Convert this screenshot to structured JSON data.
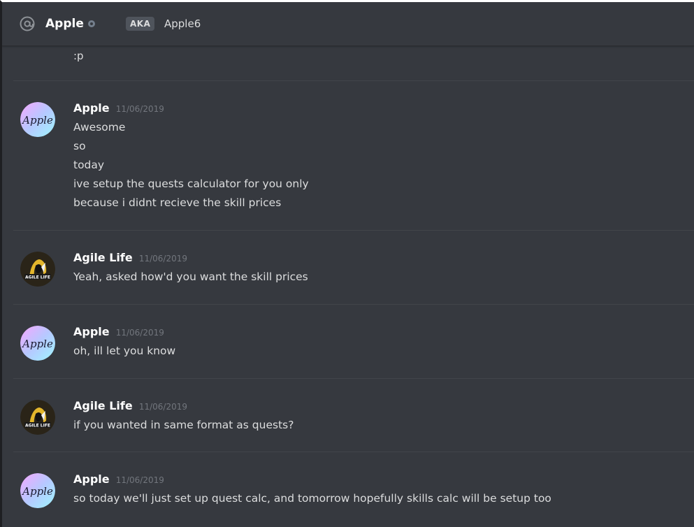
{
  "header": {
    "name": "Apple",
    "aka_label": "AKA",
    "aka_value": "Apple6"
  },
  "continuation_text": ":p",
  "messages": [
    {
      "author": "Apple",
      "timestamp": "11/06/2019",
      "avatar": "apple-avatar",
      "lines": [
        "Awesome",
        "so",
        "today",
        "ive setup the quests calculator for you only",
        "because i didnt recieve the skill prices"
      ]
    },
    {
      "author": "Agile Life",
      "timestamp": "11/06/2019",
      "avatar": "agile-life-avatar",
      "lines": [
        "Yeah, asked how'd you want the skill prices"
      ]
    },
    {
      "author": "Apple",
      "timestamp": "11/06/2019",
      "avatar": "apple-avatar",
      "lines": [
        "oh, ill let you know"
      ]
    },
    {
      "author": "Agile Life",
      "timestamp": "11/06/2019",
      "avatar": "agile-life-avatar",
      "lines": [
        "if you wanted in same format as quests?"
      ]
    },
    {
      "author": "Apple",
      "timestamp": "11/06/2019",
      "avatar": "apple-avatar",
      "lines": [
        "so today we'll just set up quest calc, and tomorrow hopefully skills calc will be setup too"
      ]
    }
  ],
  "avatars": {
    "apple_text": "Apple",
    "agile_text": "AGILE LIFE"
  },
  "colors": {
    "background": "#36393f",
    "header_text": "#ffffff",
    "message_text": "#dcddde",
    "timestamp": "#72767d",
    "status_offline": "#747f8d"
  }
}
